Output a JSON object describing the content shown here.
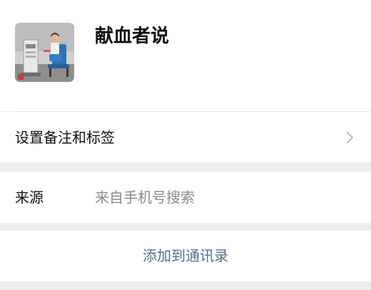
{
  "profile": {
    "name": "献血者说",
    "avatar_icon": "blood-donor-photo"
  },
  "remark": {
    "label": "设置备注和标签",
    "chevron_icon": "chevron-right-icon"
  },
  "source": {
    "label": "来源",
    "value": "来自手机号搜索"
  },
  "action": {
    "label": "添加到通讯录"
  },
  "colors": {
    "background": "#ededed",
    "card": "#ffffff",
    "primary_text": "#111111",
    "secondary_text": "#8a8a8a",
    "link": "#576b95",
    "chevron": "#b2b2b2"
  }
}
